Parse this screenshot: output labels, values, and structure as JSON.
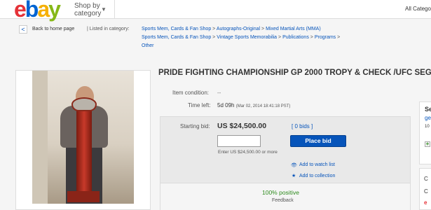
{
  "header": {
    "logo_letters": [
      "e",
      "b",
      "a",
      "y"
    ],
    "shop_by_line1": "Shop by",
    "shop_by_line2": "category",
    "all_categories": "All Catego"
  },
  "nav": {
    "back_link": "Back to home page",
    "listed_in": "| Listed in category:",
    "breadcrumb_rows": [
      [
        "Sports Mem, Cards & Fan Shop",
        "Autographs-Original",
        "Mixed Martial Arts (MMA)"
      ],
      [
        "Sports Mem, Cards & Fan Shop",
        "Vintage Sports Memorabilia",
        "Publications",
        "Programs"
      ],
      [
        "Other"
      ]
    ],
    "separator": ">"
  },
  "item": {
    "title": "PRIDE FIGHTING CHAMPIONSHIP GP 2000 TROPY & CHECK /UFC SEG",
    "condition_label": "Item condition:",
    "condition_value": "--",
    "time_left_label": "Time left:",
    "time_left_value": "5d 09h",
    "time_left_detail": "(Mar 02, 2014   18:41:18 PST)"
  },
  "bidding": {
    "starting_bid_label": "Starting bid:",
    "starting_bid_value": "US $24,500.00",
    "bids_link": "[ 0 bids ]",
    "bid_input_value": "",
    "place_bid_label": "Place bid",
    "enter_hint": "Enter US $24,500.00 or more",
    "watch_list_label": "Add to watch list",
    "collection_label": "Add to collection"
  },
  "seller_feedback": {
    "positive": "100% positive",
    "feedback_label": "Feedback"
  },
  "seller_card": {
    "line1": "Se",
    "line2": "ge",
    "line3": "10"
  },
  "side_card2": {
    "line1": "C",
    "line2": "C",
    "line3": "e"
  },
  "colors": {
    "logo_e": "#e53238",
    "logo_b": "#0064d2",
    "logo_a": "#f5af02",
    "logo_y": "#86b817",
    "link_blue": "#0654ba",
    "place_bid_bg": "#0654ba",
    "positive_green": "#2e8b1e"
  }
}
